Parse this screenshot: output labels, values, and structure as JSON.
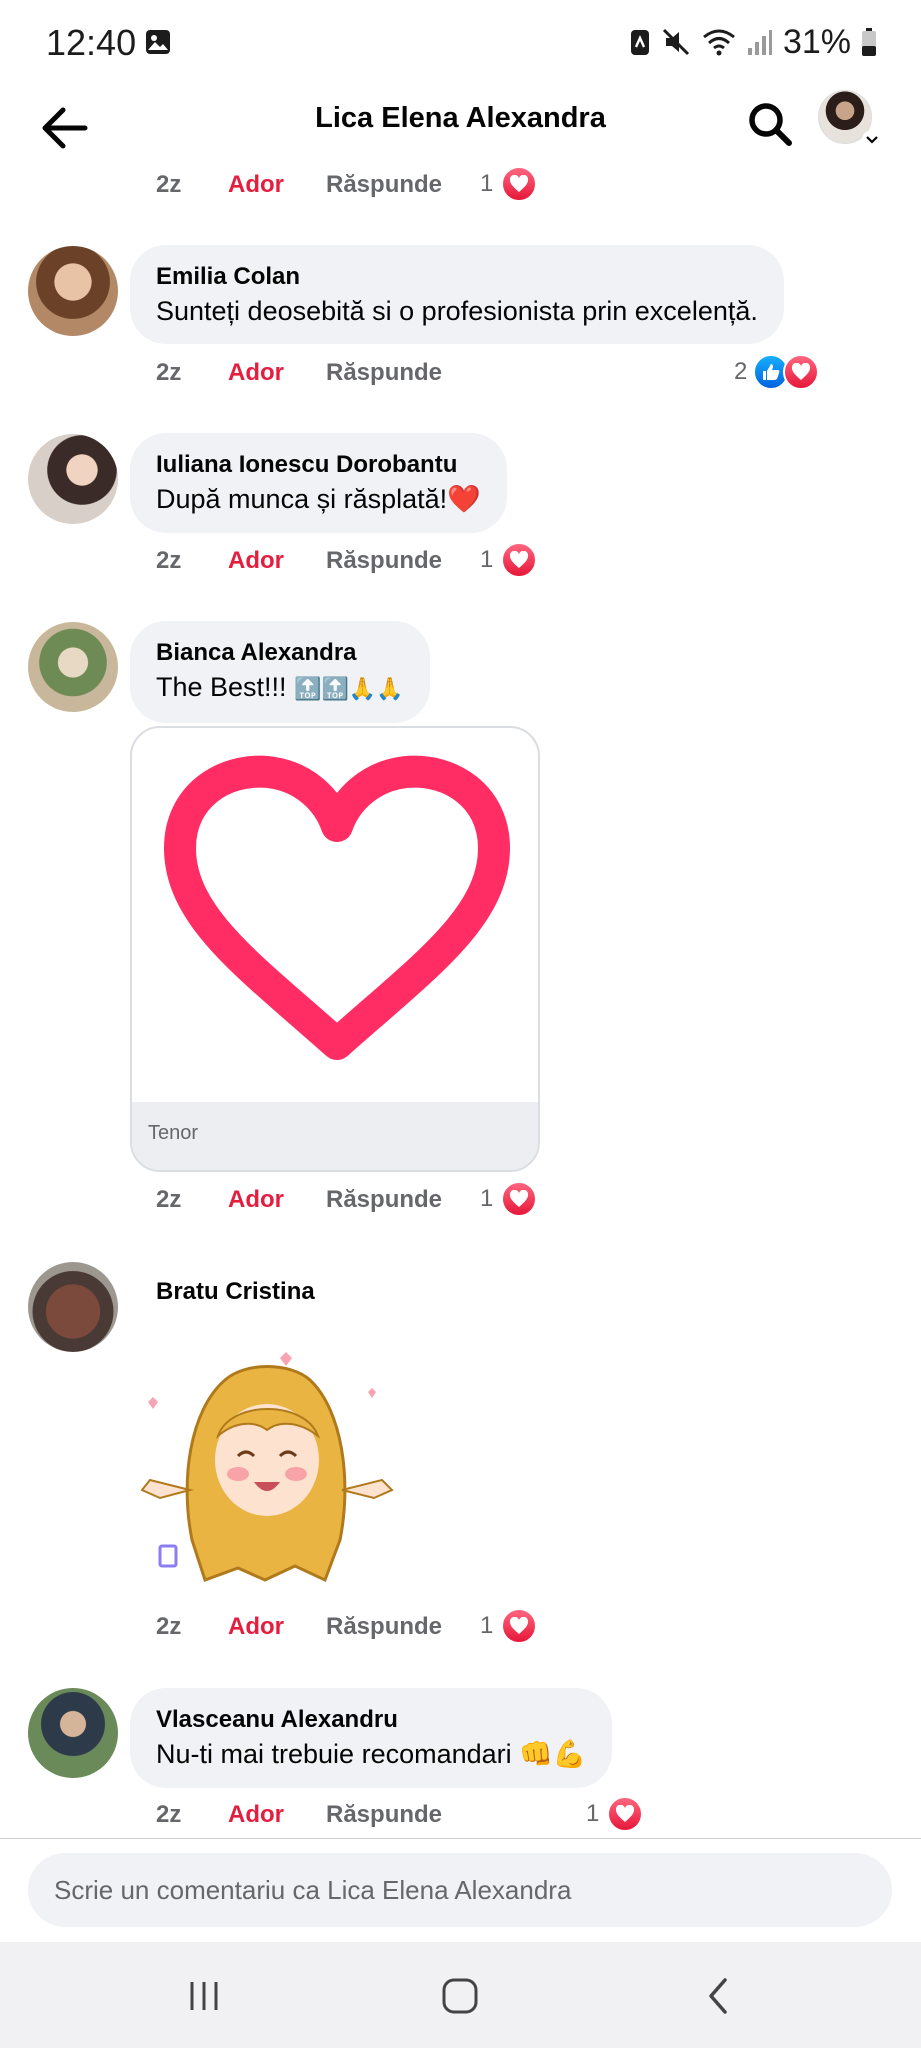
{
  "status_bar": {
    "time": "12:40",
    "battery": "31%"
  },
  "header": {
    "title": "Lica Elena Alexandra"
  },
  "top_actions": {
    "time": "2z",
    "like": "Ador",
    "reply": "Răspunde",
    "count": "1"
  },
  "comments": [
    {
      "author": "Emilia Colan",
      "text": "Sunteți deosebită si o profesionista prin excelență.",
      "time": "2z",
      "like": "Ador",
      "reply": "Răspunde",
      "count": "2"
    },
    {
      "author": "Iuliana Ionescu Dorobantu",
      "text": "După munca și răsplată!",
      "text_emoji": "❤️",
      "time": "2z",
      "like": "Ador",
      "reply": "Răspunde",
      "count": "1"
    },
    {
      "author": "Bianca Alexandra",
      "text": "The Best!!!",
      "text_emoji": "🔝🔝🙏🙏",
      "gif_source": "Tenor",
      "time": "2z",
      "like": "Ador",
      "reply": "Răspunde",
      "count": "1"
    },
    {
      "author": "Bratu Cristina",
      "time": "2z",
      "like": "Ador",
      "reply": "Răspunde",
      "count": "1"
    },
    {
      "author": "Vlasceanu Alexandru",
      "text": "Nu-ti mai trebuie recomandari",
      "text_emoji": "👊💪",
      "time": "2z",
      "like": "Ador",
      "reply": "Răspunde",
      "count": "1"
    }
  ],
  "composer": {
    "placeholder": "Scrie un comentariu ca Lica Elena Alexandra"
  },
  "colors": {
    "accent_red": "#e41e3f",
    "bubble_bg": "#f0f2f5",
    "secondary_text": "#65676b",
    "like_blue": "#0866ff"
  }
}
